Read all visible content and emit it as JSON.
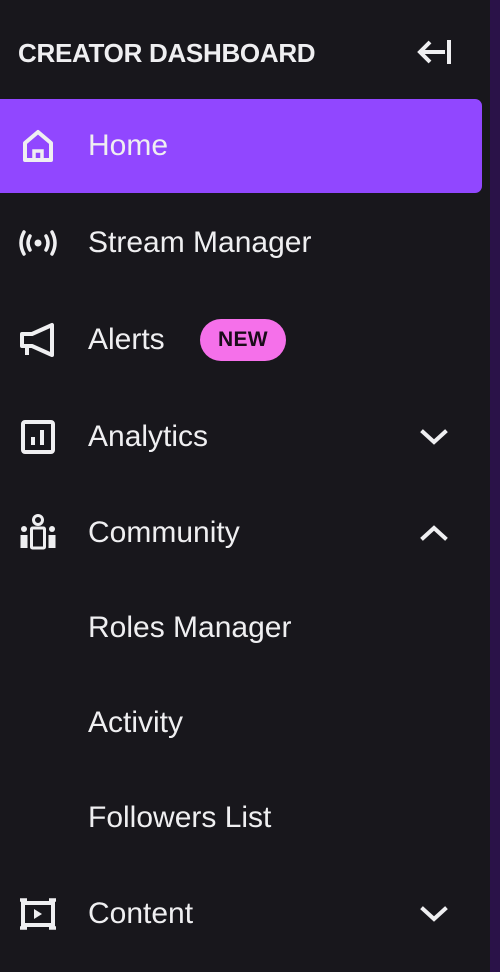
{
  "header": {
    "title": "CREATOR DASHBOARD",
    "collapse_icon": "collapse-left-icon"
  },
  "nav": {
    "items": [
      {
        "label": "Home",
        "icon": "home-icon",
        "active": true
      },
      {
        "label": "Stream Manager",
        "icon": "broadcast-icon"
      },
      {
        "label": "Alerts",
        "icon": "megaphone-icon",
        "badge": "NEW"
      },
      {
        "label": "Analytics",
        "icon": "analytics-icon",
        "expanded": false
      },
      {
        "label": "Community",
        "icon": "community-icon",
        "expanded": true
      },
      {
        "label": "Content",
        "icon": "content-icon",
        "expanded": false
      }
    ],
    "community_subitems": [
      {
        "label": "Roles Manager"
      },
      {
        "label": "Activity"
      },
      {
        "label": "Followers List"
      }
    ]
  },
  "colors": {
    "background": "#18171c",
    "accent": "#9147ff",
    "badge": "#f570ea",
    "text": "#efeff1",
    "border": "#2a1248"
  }
}
